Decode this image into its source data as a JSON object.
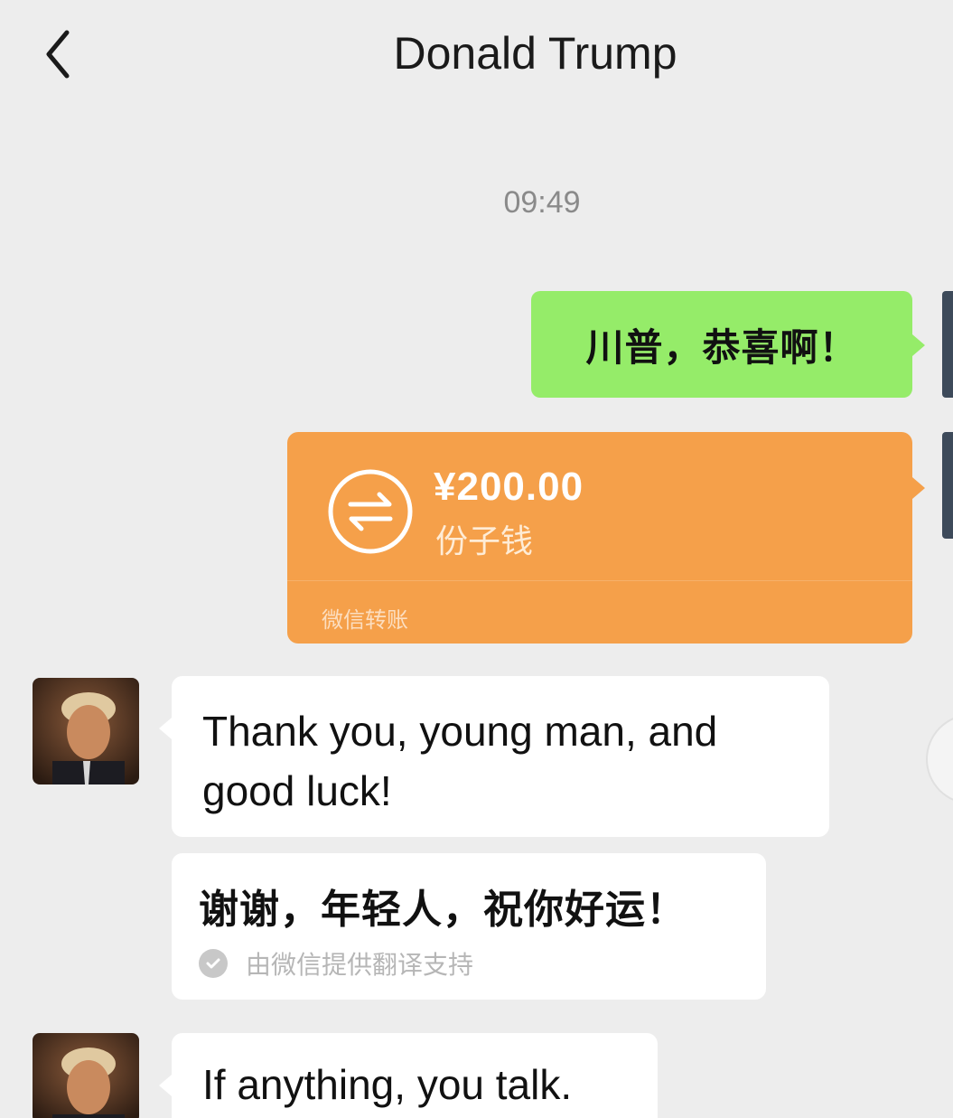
{
  "header": {
    "back_label": "<",
    "title": "Donald Trump"
  },
  "chat": {
    "timestamp": "09:49",
    "messages": [
      {
        "side": "right",
        "type": "text",
        "text": "川普，恭喜啊！"
      },
      {
        "side": "right",
        "type": "transfer",
        "amount": "¥200.00",
        "note": "份子钱",
        "source": "微信转账"
      },
      {
        "side": "left",
        "type": "text",
        "text": "Thank you, young man, and good luck!"
      },
      {
        "side": "left",
        "type": "translation",
        "text": "谢谢，年轻人，祝你好运！",
        "attribution": "由微信提供翻译支持"
      },
      {
        "side": "left",
        "type": "text",
        "text": "If anything, you talk."
      }
    ]
  },
  "colors": {
    "background": "#ededed",
    "sent_bubble": "#95ec69",
    "transfer_card": "#f5a04a",
    "received_bubble": "#ffffff"
  },
  "icons": {
    "back": "chevron-left-icon",
    "transfer": "transfer-arrows-icon",
    "check": "check-circle-icon"
  }
}
